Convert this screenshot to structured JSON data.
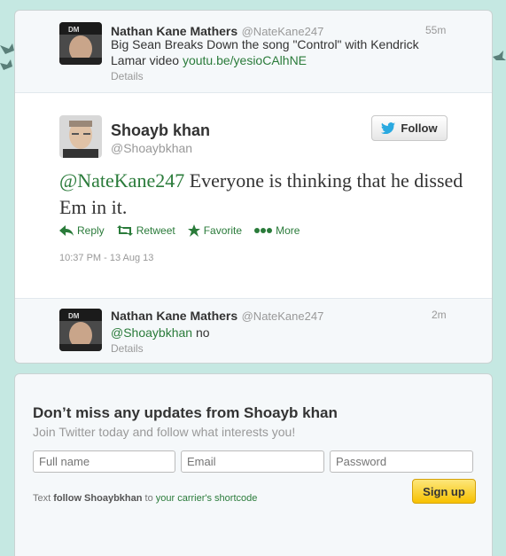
{
  "tweets_before": {
    "name": "Nathan Kane Mathers",
    "handle": "@NateKane247",
    "time": "55m",
    "text": "Big Sean Breaks Down the song \"Control\" with Kendrick Lamar  video ",
    "link": "youtu.be/yesioCAlhNE",
    "details": "Details"
  },
  "main_tweet": {
    "name": "Shoayb khan",
    "handle": "@Shoaybkhan",
    "follow_label": "Follow",
    "mention": "@NateKane247",
    "text": " Everyone is thinking that he dissed Em in it.",
    "actions": {
      "reply": "Reply",
      "retweet": "Retweet",
      "favorite": "Favorite",
      "more": "More"
    },
    "timestamp": "10:37 PM - 13 Aug 13"
  },
  "tweets_after": {
    "name": "Nathan Kane Mathers",
    "handle": "@NateKane247",
    "time": "2m",
    "mention": "@Shoaybkhan",
    "text": " no",
    "details": "Details"
  },
  "signup": {
    "title": "Don’t miss any updates from Shoayb khan",
    "subtitle": "Join Twitter today and follow what interests you!",
    "fullname_placeholder": "Full name",
    "email_placeholder": "Email",
    "password_placeholder": "Password",
    "signup_label": "Sign up",
    "sms_prefix": "Text ",
    "sms_bold": "follow Shoaybkhan",
    "sms_mid": " to ",
    "sms_link": "your carrier's shortcode"
  },
  "colors": {
    "background": "#c5e8e2",
    "link": "#2a7b3a",
    "twitter_blue": "#2aa9e0",
    "signup_yellow": "#f7c100"
  },
  "icons": [
    "twitter-bird-icon",
    "reply-icon",
    "retweet-icon",
    "favorite-star-icon",
    "more-dots-icon"
  ]
}
